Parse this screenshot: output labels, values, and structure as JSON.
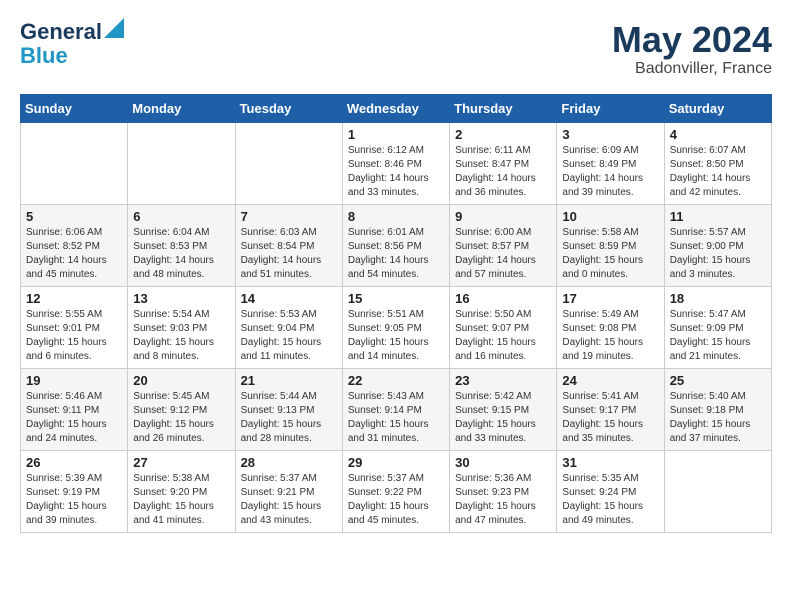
{
  "logo": {
    "line1": "General",
    "line2": "Blue"
  },
  "title": "May 2024",
  "subtitle": "Badonviller, France",
  "weekdays": [
    "Sunday",
    "Monday",
    "Tuesday",
    "Wednesday",
    "Thursday",
    "Friday",
    "Saturday"
  ],
  "weeks": [
    [
      {
        "day": "",
        "info": ""
      },
      {
        "day": "",
        "info": ""
      },
      {
        "day": "",
        "info": ""
      },
      {
        "day": "1",
        "info": "Sunrise: 6:12 AM\nSunset: 8:46 PM\nDaylight: 14 hours\nand 33 minutes."
      },
      {
        "day": "2",
        "info": "Sunrise: 6:11 AM\nSunset: 8:47 PM\nDaylight: 14 hours\nand 36 minutes."
      },
      {
        "day": "3",
        "info": "Sunrise: 6:09 AM\nSunset: 8:49 PM\nDaylight: 14 hours\nand 39 minutes."
      },
      {
        "day": "4",
        "info": "Sunrise: 6:07 AM\nSunset: 8:50 PM\nDaylight: 14 hours\nand 42 minutes."
      }
    ],
    [
      {
        "day": "5",
        "info": "Sunrise: 6:06 AM\nSunset: 8:52 PM\nDaylight: 14 hours\nand 45 minutes."
      },
      {
        "day": "6",
        "info": "Sunrise: 6:04 AM\nSunset: 8:53 PM\nDaylight: 14 hours\nand 48 minutes."
      },
      {
        "day": "7",
        "info": "Sunrise: 6:03 AM\nSunset: 8:54 PM\nDaylight: 14 hours\nand 51 minutes."
      },
      {
        "day": "8",
        "info": "Sunrise: 6:01 AM\nSunset: 8:56 PM\nDaylight: 14 hours\nand 54 minutes."
      },
      {
        "day": "9",
        "info": "Sunrise: 6:00 AM\nSunset: 8:57 PM\nDaylight: 14 hours\nand 57 minutes."
      },
      {
        "day": "10",
        "info": "Sunrise: 5:58 AM\nSunset: 8:59 PM\nDaylight: 15 hours\nand 0 minutes."
      },
      {
        "day": "11",
        "info": "Sunrise: 5:57 AM\nSunset: 9:00 PM\nDaylight: 15 hours\nand 3 minutes."
      }
    ],
    [
      {
        "day": "12",
        "info": "Sunrise: 5:55 AM\nSunset: 9:01 PM\nDaylight: 15 hours\nand 6 minutes."
      },
      {
        "day": "13",
        "info": "Sunrise: 5:54 AM\nSunset: 9:03 PM\nDaylight: 15 hours\nand 8 minutes."
      },
      {
        "day": "14",
        "info": "Sunrise: 5:53 AM\nSunset: 9:04 PM\nDaylight: 15 hours\nand 11 minutes."
      },
      {
        "day": "15",
        "info": "Sunrise: 5:51 AM\nSunset: 9:05 PM\nDaylight: 15 hours\nand 14 minutes."
      },
      {
        "day": "16",
        "info": "Sunrise: 5:50 AM\nSunset: 9:07 PM\nDaylight: 15 hours\nand 16 minutes."
      },
      {
        "day": "17",
        "info": "Sunrise: 5:49 AM\nSunset: 9:08 PM\nDaylight: 15 hours\nand 19 minutes."
      },
      {
        "day": "18",
        "info": "Sunrise: 5:47 AM\nSunset: 9:09 PM\nDaylight: 15 hours\nand 21 minutes."
      }
    ],
    [
      {
        "day": "19",
        "info": "Sunrise: 5:46 AM\nSunset: 9:11 PM\nDaylight: 15 hours\nand 24 minutes."
      },
      {
        "day": "20",
        "info": "Sunrise: 5:45 AM\nSunset: 9:12 PM\nDaylight: 15 hours\nand 26 minutes."
      },
      {
        "day": "21",
        "info": "Sunrise: 5:44 AM\nSunset: 9:13 PM\nDaylight: 15 hours\nand 28 minutes."
      },
      {
        "day": "22",
        "info": "Sunrise: 5:43 AM\nSunset: 9:14 PM\nDaylight: 15 hours\nand 31 minutes."
      },
      {
        "day": "23",
        "info": "Sunrise: 5:42 AM\nSunset: 9:15 PM\nDaylight: 15 hours\nand 33 minutes."
      },
      {
        "day": "24",
        "info": "Sunrise: 5:41 AM\nSunset: 9:17 PM\nDaylight: 15 hours\nand 35 minutes."
      },
      {
        "day": "25",
        "info": "Sunrise: 5:40 AM\nSunset: 9:18 PM\nDaylight: 15 hours\nand 37 minutes."
      }
    ],
    [
      {
        "day": "26",
        "info": "Sunrise: 5:39 AM\nSunset: 9:19 PM\nDaylight: 15 hours\nand 39 minutes."
      },
      {
        "day": "27",
        "info": "Sunrise: 5:38 AM\nSunset: 9:20 PM\nDaylight: 15 hours\nand 41 minutes."
      },
      {
        "day": "28",
        "info": "Sunrise: 5:37 AM\nSunset: 9:21 PM\nDaylight: 15 hours\nand 43 minutes."
      },
      {
        "day": "29",
        "info": "Sunrise: 5:37 AM\nSunset: 9:22 PM\nDaylight: 15 hours\nand 45 minutes."
      },
      {
        "day": "30",
        "info": "Sunrise: 5:36 AM\nSunset: 9:23 PM\nDaylight: 15 hours\nand 47 minutes."
      },
      {
        "day": "31",
        "info": "Sunrise: 5:35 AM\nSunset: 9:24 PM\nDaylight: 15 hours\nand 49 minutes."
      },
      {
        "day": "",
        "info": ""
      }
    ]
  ]
}
